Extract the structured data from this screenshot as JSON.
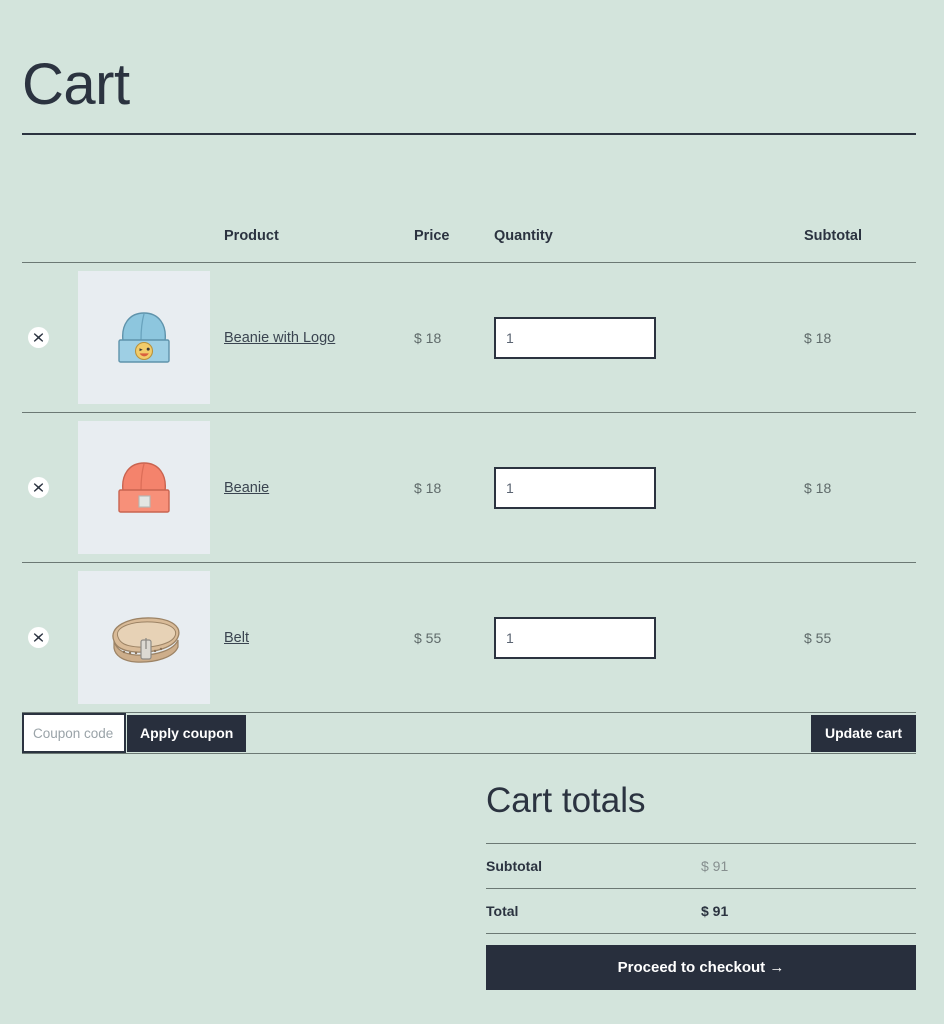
{
  "page": {
    "title": "Cart"
  },
  "table": {
    "headers": {
      "remove": "",
      "thumb": "",
      "product": "Product",
      "price": "Price",
      "quantity": "Quantity",
      "subtotal": "Subtotal"
    },
    "remove_icon": "close-x-icon",
    "rows": [
      {
        "remove_label": "×",
        "image": "blue-beanie-with-logo-thumbnail",
        "name": "Beanie with Logo",
        "price": "$ 18",
        "quantity": "1",
        "subtotal": "$ 18"
      },
      {
        "remove_label": "×",
        "image": "red-beanie-thumbnail",
        "name": "Beanie",
        "price": "$ 18",
        "quantity": "1",
        "subtotal": "$ 18"
      },
      {
        "remove_label": "×",
        "image": "tan-leather-belt-thumbnail",
        "name": "Belt",
        "price": "$ 55",
        "quantity": "1",
        "subtotal": "$ 55"
      }
    ]
  },
  "coupon": {
    "value": "",
    "placeholder": "Coupon code",
    "apply_label": "Apply coupon",
    "update_label": "Update cart"
  },
  "totals": {
    "title": "Cart totals",
    "rows": [
      {
        "label": "Subtotal",
        "value": "$ 91"
      },
      {
        "label": "Total",
        "value": "$ 91"
      }
    ],
    "checkout_label": "Proceed to checkout  →"
  },
  "colors": {
    "background": "#d3e4dc",
    "ink": "#2b3340",
    "dark_button": "#282f3d",
    "thumbnail_bg": "#e8edf1",
    "rule": "#6b7874"
  }
}
